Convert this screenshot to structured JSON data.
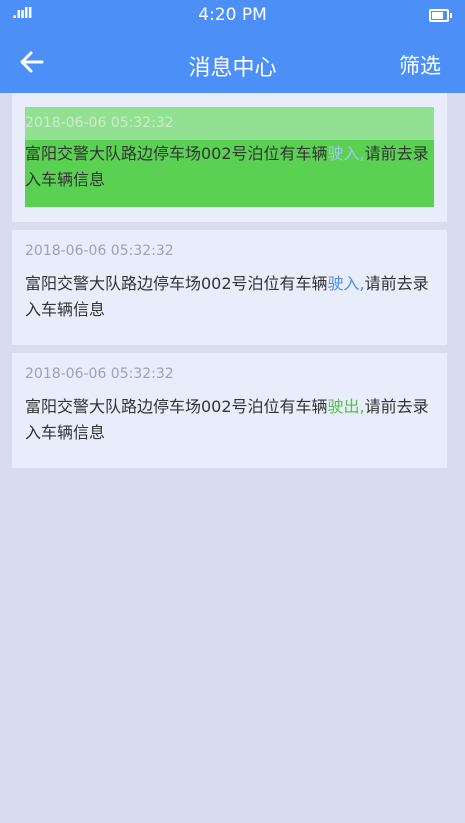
{
  "status_bar": {
    "signal": ".ııll",
    "time": "4:20 PM"
  },
  "nav": {
    "title": "消息中心",
    "filter_label": "筛选"
  },
  "messages": [
    {
      "timestamp": "2018-06-06   05:32:32",
      "text_before": "富阳交警大队路边停车场002号泊位有车辆",
      "action": "驶入,",
      "text_after": "请前去录入车辆信息"
    },
    {
      "timestamp": "2018-06-06   05:32:32",
      "text_before": "富阳交警大队路边停车场002号泊位有车辆",
      "action": "驶入,",
      "text_after": "请前去录入车辆信息"
    },
    {
      "timestamp": "2018-06-06   05:32:32",
      "text_before": "富阳交警大队路边停车场002号泊位有车辆",
      "action": "驶出,",
      "text_after": "请前去录入车辆信息"
    }
  ]
}
